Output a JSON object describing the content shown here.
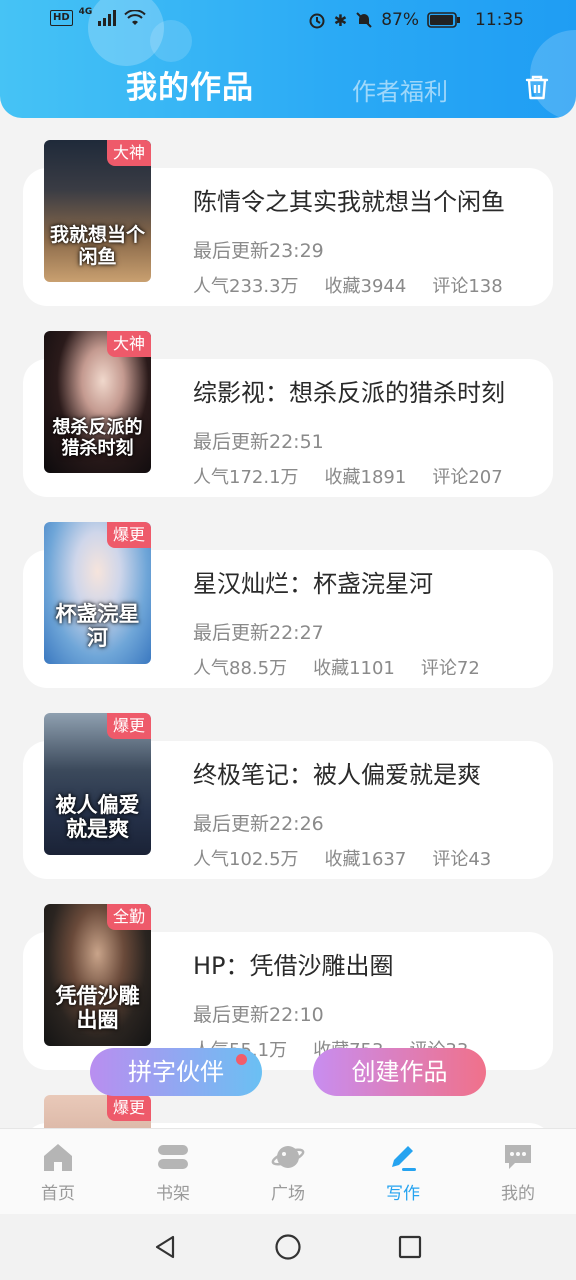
{
  "status_bar": {
    "network": "4G",
    "hd": "HD",
    "battery": "87%",
    "time": "11:35"
  },
  "header": {
    "tab_active": "我的作品",
    "tab_inactive": "作者福利"
  },
  "works": [
    {
      "badge": "大神",
      "cover_text": "我就想当个闲鱼",
      "title": "陈情令之其实我就想当个闲鱼",
      "updated": "最后更新23:29",
      "popularity": "人气233.3万",
      "favorites": "收藏3944",
      "comments": "评论138"
    },
    {
      "badge": "大神",
      "cover_text": "想杀反派的猎杀时刻",
      "title": "综影视：想杀反派的猎杀时刻",
      "updated": "最后更新22:51",
      "popularity": "人气172.1万",
      "favorites": "收藏1891",
      "comments": "评论207"
    },
    {
      "badge": "爆更",
      "cover_text": "杯盏浣星河",
      "title": "星汉灿烂：杯盏浣星河",
      "updated": "最后更新22:27",
      "popularity": "人气88.5万",
      "favorites": "收藏1101",
      "comments": "评论72"
    },
    {
      "badge": "爆更",
      "cover_text": "被人偏爱就是爽",
      "title": "终极笔记：被人偏爱就是爽",
      "updated": "最后更新22:26",
      "popularity": "人气102.5万",
      "favorites": "收藏1637",
      "comments": "评论43"
    },
    {
      "badge": "全勤",
      "cover_text": "凭借沙雕出圈",
      "title": "HP：凭借沙雕出圈",
      "updated": "最后更新22:10",
      "popularity": "人气55.1万",
      "favorites": "收藏753",
      "comments": "评论33"
    },
    {
      "badge": "爆更",
      "cover_text": "",
      "title": "",
      "updated": "",
      "popularity": "",
      "favorites": "",
      "comments": ""
    }
  ],
  "floating_buttons": {
    "partner": "拼字伙伴",
    "create": "创建作品"
  },
  "bottom_nav": [
    {
      "label": "首页",
      "icon": "home-icon"
    },
    {
      "label": "书架",
      "icon": "bookshelf-icon"
    },
    {
      "label": "广场",
      "icon": "planet-icon"
    },
    {
      "label": "写作",
      "icon": "pen-icon"
    },
    {
      "label": "我的",
      "icon": "chat-bubble-icon"
    }
  ],
  "colors": {
    "accent": "#25a3f0",
    "badge": "#ee5a6a",
    "header_start": "#46c3f5",
    "header_end": "#1f9df3"
  }
}
